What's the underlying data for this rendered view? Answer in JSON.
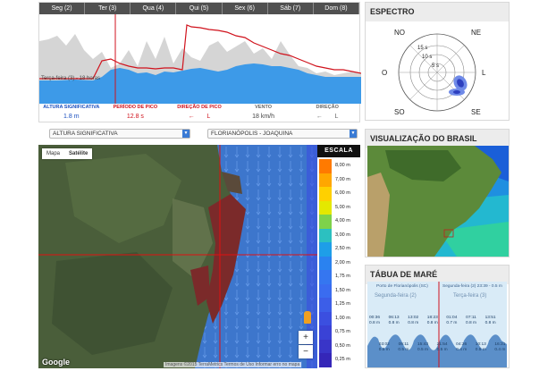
{
  "forecast": {
    "days": [
      "Seg (2)",
      "Ter (3)",
      "Qua (4)",
      "Qui (5)",
      "Sex (6)",
      "Sáb (7)",
      "Dom (8)"
    ],
    "tooltip": "Terça-feira (3) - 18 horas",
    "metrics": [
      {
        "label": "ALTURA SIGNIFICATIVA",
        "value": "1.8 m",
        "label_color": "#1a4fbf",
        "value_color": "#1a4fbf"
      },
      {
        "label": "PERÍODO DE PICO",
        "value": "12.8 s",
        "label_color": "#d0121c",
        "value_color": "#d0121c"
      },
      {
        "label": "DIREÇÃO DE PICO",
        "value": "L",
        "arrow": "←",
        "label_color": "#d0121c",
        "value_color": "#d0121c"
      },
      {
        "label": "VENTO",
        "value": "18 km/h",
        "label_color": "#666666",
        "value_color": "#444444"
      },
      {
        "label": "DIREÇÃO",
        "value": "L",
        "arrow": "←",
        "label_color": "#666666",
        "value_color": "#666666"
      }
    ]
  },
  "spectrum": {
    "title": "ESPECTRO",
    "directions": {
      "n": "NO",
      "ne": "NE",
      "l": "L",
      "se": "SE",
      "s": "SO",
      "o": "O",
      "no": "SO"
    },
    "compass": [
      "NO",
      "NE",
      "L",
      "SE",
      "SO",
      "O"
    ],
    "rings": [
      "15 s",
      "10 s",
      "5 s"
    ]
  },
  "controls": {
    "variable": "ALTURA SIGNIFICATIVA",
    "location": "FLORIANÓPOLIS - JOAQUINA"
  },
  "map": {
    "toggle_map": "Mapa",
    "toggle_sat": "Satélite",
    "scale_title": "ESCALA",
    "scale": [
      {
        "label": "8,00 m",
        "color": "#ff7a00"
      },
      {
        "label": "7,00 m",
        "color": "#ffa700"
      },
      {
        "label": "6,00 m",
        "color": "#ffd000"
      },
      {
        "label": "5,00 m",
        "color": "#e4e800"
      },
      {
        "label": "4,00 m",
        "color": "#7ed24a"
      },
      {
        "label": "3,00 m",
        "color": "#2cc0c0"
      },
      {
        "label": "2,50 m",
        "color": "#1e9ee8"
      },
      {
        "label": "2,00 m",
        "color": "#2a82f0"
      },
      {
        "label": "1,75 m",
        "color": "#3576f0"
      },
      {
        "label": "1,50 m",
        "color": "#3a6cf0"
      },
      {
        "label": "1,25 m",
        "color": "#3c5ee8"
      },
      {
        "label": "1,00 m",
        "color": "#3b4fe0"
      },
      {
        "label": "0,75 m",
        "color": "#3a42d6"
      },
      {
        "label": "0,50 m",
        "color": "#3935c8"
      },
      {
        "label": "0,25 m",
        "color": "#3526b8"
      }
    ],
    "zoom_in": "+",
    "zoom_out": "−",
    "attribution": "Imagens ©2015 TerraMetrics   Termos de Uso   Informar erro no mapa",
    "logo": "Google"
  },
  "brasil": {
    "title": "VISUALIZAÇÃO DO BRASIL"
  },
  "tide": {
    "title": "TÁBUA DE MARÉ",
    "header_left": "Porto de Florianópolis (SC)",
    "header_right": "Segunda-feira (2) 23:39 - 0.5 m",
    "day_left": "Segunda-feira (2)",
    "day_right": "Terça-feira (3)",
    "extremes": [
      {
        "time": "00:36",
        "height": "0.8 m",
        "kind": "high"
      },
      {
        "time": "03:02",
        "height": "0.5 m",
        "kind": "low"
      },
      {
        "time": "06:13",
        "height": "0.8 m",
        "kind": "high"
      },
      {
        "time": "09:11",
        "height": "0.5 m",
        "kind": "low"
      },
      {
        "time": "13:02",
        "height": "0.8 m",
        "kind": "high"
      },
      {
        "time": "15:43",
        "height": "0.5 m",
        "kind": "low"
      },
      {
        "time": "18:23",
        "height": "0.8 m",
        "kind": "high"
      },
      {
        "time": "21:54",
        "height": "0.5 m",
        "kind": "low"
      },
      {
        "time": "01:04",
        "height": "0.7 m",
        "kind": "high"
      },
      {
        "time": "04:26",
        "height": "0.4 m",
        "kind": "low"
      },
      {
        "time": "07:11",
        "height": "0.8 m",
        "kind": "high"
      },
      {
        "time": "10:13",
        "height": "0.5 m",
        "kind": "low"
      },
      {
        "time": "13:51",
        "height": "0.8 m",
        "kind": "high"
      },
      {
        "time": "16:31",
        "height": "0.4 m",
        "kind": "low"
      }
    ]
  }
}
